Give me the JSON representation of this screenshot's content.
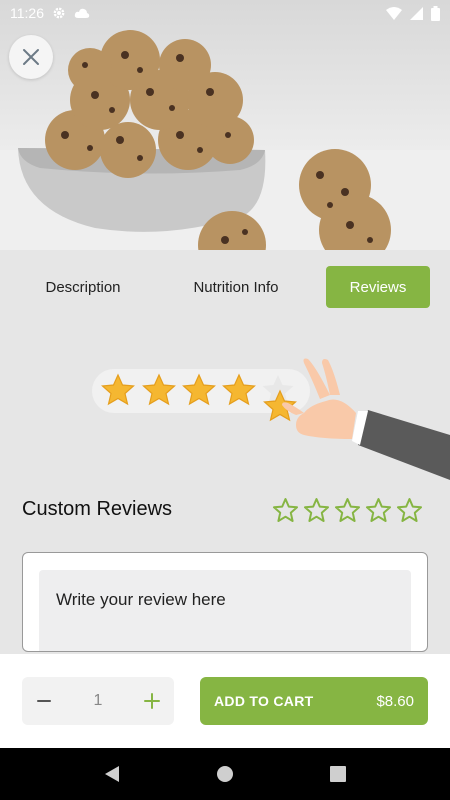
{
  "status_bar": {
    "time": "11:26"
  },
  "tabs": [
    {
      "label": "Description",
      "active": false
    },
    {
      "label": "Nutrition Info",
      "active": false
    },
    {
      "label": "Reviews",
      "active": true
    }
  ],
  "reviews": {
    "title": "Custom Reviews",
    "user_rating": 0,
    "max_rating": 5,
    "placeholder": "Write your review here"
  },
  "cart": {
    "quantity": "1",
    "add_label": "ADD TO CART",
    "price": "$8.60"
  },
  "colors": {
    "accent": "#86b543",
    "star": "#f5b731",
    "nav_bar": "#000000"
  },
  "icons": [
    "settings-icon",
    "cloud-icon",
    "wifi-icon",
    "cellular-icon",
    "battery-icon",
    "close-icon",
    "star-outline-icon",
    "minus-icon",
    "plus-icon",
    "back-icon",
    "home-icon",
    "recents-icon"
  ]
}
